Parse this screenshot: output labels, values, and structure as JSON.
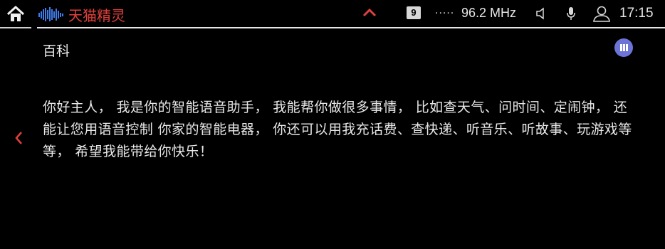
{
  "status_bar": {
    "app_title": "天猫精灵",
    "badge_number": "9",
    "signal_dots": ".....",
    "radio_frequency": "96.2 MHz",
    "time": "17:15"
  },
  "content": {
    "section_title": "百科",
    "message": "你好主人， 我是你的智能语音助手， 我能帮你做很多事情， 比如查天气、问时间、定闹钟， 还能让您用语音控制 你家的智能电器， 你还可以用我充话费、查快递、听音乐、听故事、玩游戏等等， 希望我能带给你快乐！"
  },
  "colors": {
    "background": "#000000",
    "accent_red": "#e0403c",
    "badge_purple": "#6c74d8",
    "text": "#e8e8e8"
  },
  "icons": {
    "home": "home-icon",
    "logo": "tmall-genie-logo",
    "up": "chevron-up-icon",
    "speaker": "speaker-icon",
    "mic": "mic-icon",
    "user": "user-icon",
    "back": "chevron-left-icon",
    "app_badge": "grid-icon"
  }
}
